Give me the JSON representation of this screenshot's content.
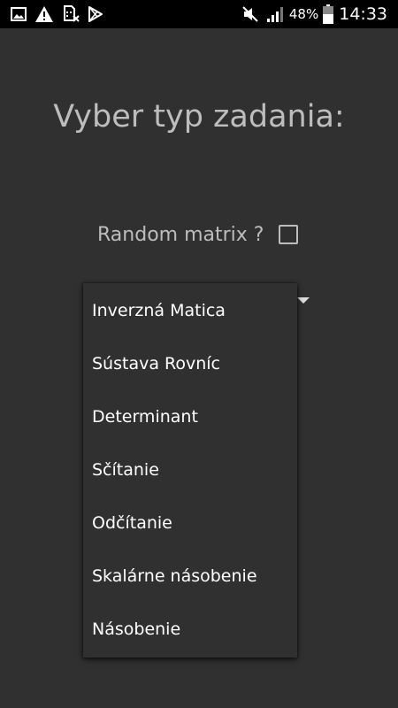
{
  "status_bar": {
    "left_icons": [
      "gallery-icon",
      "warning-icon",
      "sim-off-icon",
      "play-store-icon"
    ],
    "right_icons": [
      "mute-icon",
      "signal-icon",
      "battery-icon"
    ],
    "battery_percent": "48%",
    "time": "14:33"
  },
  "main": {
    "title": "Vyber typ zadania:",
    "random_label": "Random matrix ?",
    "random_checked": false
  },
  "dropdown": {
    "items": [
      "Inverzná Matica",
      "Sústava Rovníc",
      "Determinant",
      "Sčítanie",
      "Odčítanie",
      "Skalárne násobenie",
      "Násobenie"
    ]
  }
}
